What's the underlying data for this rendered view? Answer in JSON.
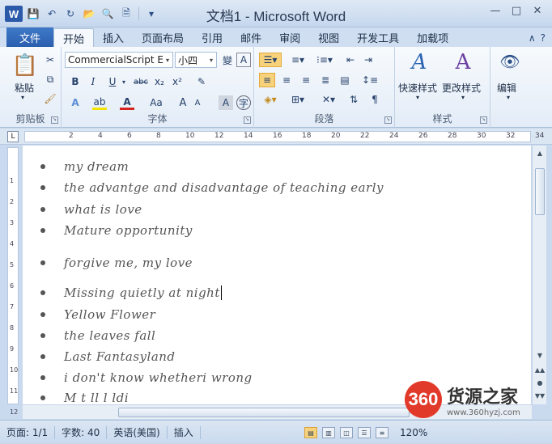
{
  "app": {
    "logo_letter": "W",
    "title": "文档1 - Microsoft Word"
  },
  "window_controls": {
    "minimize": "—",
    "restore": "□",
    "close": "✕"
  },
  "qat": {
    "save": "💾",
    "undo": "↶",
    "redo": "↻",
    "open": "📂",
    "print_preview": "🔍",
    "print": "🗎",
    "customize": "▾"
  },
  "tabs": {
    "file": "文件",
    "items": [
      "开始",
      "插入",
      "页面布局",
      "引用",
      "邮件",
      "审阅",
      "视图",
      "开发工具",
      "加载项"
    ],
    "active_index": 0
  },
  "ribbon": {
    "clipboard": {
      "label": "剪贴板",
      "paste": "粘贴"
    },
    "font": {
      "label": "字体",
      "font_name": "CommercialScript E",
      "font_size": "小四",
      "bold": "B",
      "italic": "I",
      "underline": "U",
      "strike": "abc",
      "subscript": "x₂",
      "superscript": "x²",
      "grow": "A",
      "shrink": "A",
      "case": "Aa"
    },
    "paragraph": {
      "label": "段落"
    },
    "styles": {
      "label": "样式",
      "quick_styles": "快速样式",
      "change_styles": "更改样式"
    },
    "editing": {
      "label": "编辑",
      "find": "编辑"
    }
  },
  "ruler": {
    "ticks": [
      "2",
      "4",
      "6",
      "8",
      "10",
      "12",
      "14",
      "16",
      "18",
      "20",
      "22",
      "24",
      "26",
      "28",
      "30",
      "32",
      "34"
    ],
    "corner": "L"
  },
  "vruler": {
    "ticks": [
      "1",
      "2",
      "3",
      "4",
      "5",
      "6",
      "7",
      "8",
      "9",
      "10",
      "11",
      "12"
    ]
  },
  "document": {
    "bullets": [
      "my dream",
      "the advantge and disadvantage of teaching early",
      "what is love",
      "Mature opportunity",
      "forgive me,   my love",
      "Missing quietly at night",
      "Yellow Flower",
      "the leaves fall",
      "Last Fantasyland",
      "i don't know whetheri wrong",
      "M    t    ll    l    ldi"
    ]
  },
  "status": {
    "page": "页面: 1/1",
    "words": "字数: 40",
    "language": "英语(美国)",
    "mode": "插入",
    "zoom": "120%"
  },
  "watermark": {
    "logo": "360",
    "name": "货源之家",
    "url": "www.360hyzj.com"
  },
  "colors": {
    "accent": "#2b5aa8",
    "file_tab": "#2a5fae",
    "highlight": "#f8d27b",
    "watermark_red": "#e23a2a"
  }
}
